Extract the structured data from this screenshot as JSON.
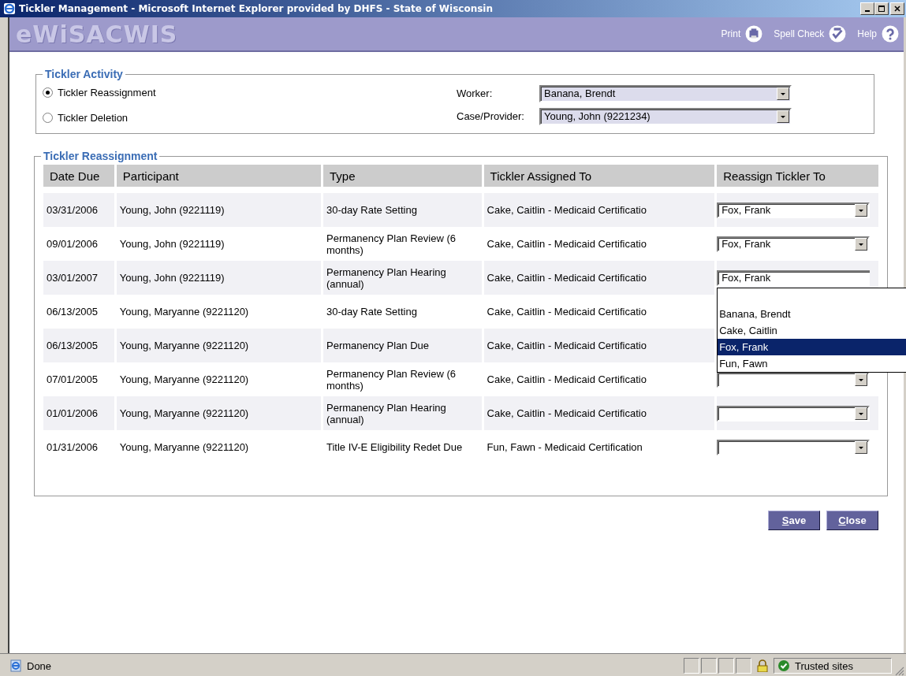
{
  "window": {
    "title": "Tickler Management - Microsoft Internet Explorer provided by DHFS - State of Wisconsin"
  },
  "header": {
    "logo": "eWiSACWIS",
    "tools": [
      {
        "label": "Print",
        "kind": "print"
      },
      {
        "label": "Spell Check",
        "kind": "spell"
      },
      {
        "label": "Help",
        "kind": "help"
      }
    ]
  },
  "activity": {
    "legend": "Tickler Activity",
    "options": [
      {
        "label": "Tickler Reassignment",
        "selected": true
      },
      {
        "label": "Tickler Deletion",
        "selected": false
      }
    ],
    "fields": [
      {
        "label": "Worker:",
        "value": "Banana, Brendt"
      },
      {
        "label": "Case/Provider:",
        "value": "Young, John (9221234)"
      }
    ]
  },
  "reassignment": {
    "legend": "Tickler Reassignment",
    "columns": [
      "Date Due",
      "Participant",
      "Type",
      "Tickler Assigned To",
      "Reassign Tickler To"
    ],
    "rows": [
      {
        "date": "03/31/2006",
        "participant": "Young, John (9221119)",
        "type": "30-day Rate Setting",
        "assigned": "Cake, Caitlin - Medicaid Certificatio",
        "reassign": {
          "kind": "dropdown",
          "value": "Fox, Frank"
        }
      },
      {
        "date": "09/01/2006",
        "participant": "Young, John (9221119)",
        "type": "Permanency Plan Review (6 months)",
        "assigned": "Cake, Caitlin - Medicaid Certificatio",
        "reassign": {
          "kind": "dropdown",
          "value": "Fox, Frank"
        }
      },
      {
        "date": "03/01/2007",
        "participant": "Young, John (9221119)",
        "type": "Permanency Plan Hearing (annual)",
        "assigned": "Cake, Caitlin - Medicaid Certificatio",
        "reassign": {
          "kind": "open",
          "value": "Fox, Frank",
          "options": [
            {
              "label": "Banana, Brendt",
              "selected": false
            },
            {
              "label": "Cake, Caitlin",
              "selected": false
            },
            {
              "label": "Fox, Frank",
              "selected": true
            },
            {
              "label": "Fun, Fawn",
              "selected": false
            }
          ]
        }
      },
      {
        "date": "06/13/2005",
        "participant": "Young, Maryanne (9221120)",
        "type": "30-day Rate Setting",
        "assigned": "Cake, Caitlin - Medicaid Certificatio",
        "reassign": {
          "kind": "hidden"
        }
      },
      {
        "date": "06/13/2005",
        "participant": "Young, Maryanne (9221120)",
        "type": "Permanency Plan Due",
        "assigned": "Cake, Caitlin - Medicaid Certificatio",
        "reassign": {
          "kind": "hidden"
        }
      },
      {
        "date": "07/01/2005",
        "participant": "Young, Maryanne (9221120)",
        "type": "Permanency Plan Review (6 months)",
        "assigned": "Cake, Caitlin - Medicaid Certificatio",
        "reassign": {
          "kind": "dropdown"
        }
      },
      {
        "date": "01/01/2006",
        "participant": "Young, Maryanne (9221120)",
        "type": "Permanency Plan Hearing (annual)",
        "assigned": "Cake, Caitlin - Medicaid Certificatio",
        "reassign": {
          "kind": "dropdown"
        }
      },
      {
        "date": "01/31/2006",
        "participant": "Young, Maryanne (9221120)",
        "type": "Title IV-E Eligibility Redet Due",
        "assigned": "Fun, Fawn - Medicaid Certification",
        "reassign": {
          "kind": "dropdown"
        }
      }
    ]
  },
  "buttons": [
    "Save",
    "Close"
  ],
  "status_bar": {
    "text": "Done",
    "zone": "Trusted sites"
  }
}
